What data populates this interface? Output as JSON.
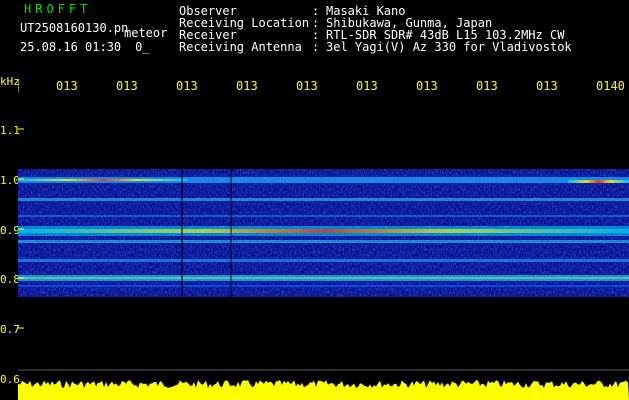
{
  "header": {
    "brand": "HROFFT",
    "filename": "UT2508160130.pn",
    "category": "meteor",
    "timestamp": "25.08.16 01:30",
    "count": "0_",
    "info": [
      {
        "label": "Observer",
        "value": "Masaki Kano"
      },
      {
        "label": "Receiving Location",
        "value": "Shibukawa, Gunma, Japan"
      },
      {
        "label": "Receiver",
        "value": "RTL-SDR SDR# 43dB L15 103.2MHz CW"
      },
      {
        "label": "Receiving Antenna",
        "value": "3el Yagi(V) Az 330 for Vladivostok"
      }
    ],
    "separator": ":"
  },
  "axis": {
    "unit": "kHz",
    "y_ticks": [
      "1.1",
      "1.0",
      "0.9",
      "0.8",
      "0.7",
      "0.6"
    ],
    "x_ticks": [
      "013",
      "013",
      "013",
      "013",
      "013",
      "013",
      "013",
      "013",
      "013",
      "0140"
    ]
  },
  "colors": {
    "header_green": "#00e000",
    "label_white": "#ffffff",
    "axis_yellow": "#ffff00",
    "background": "#000000",
    "spectrum_bg": "#000a8c"
  },
  "signal_bands_khz": [
    1.0,
    0.965,
    0.93,
    0.9,
    0.875,
    0.84,
    0.81,
    0.79
  ],
  "icons": {
    "tick_marker": "yellow-vertical-tick"
  }
}
